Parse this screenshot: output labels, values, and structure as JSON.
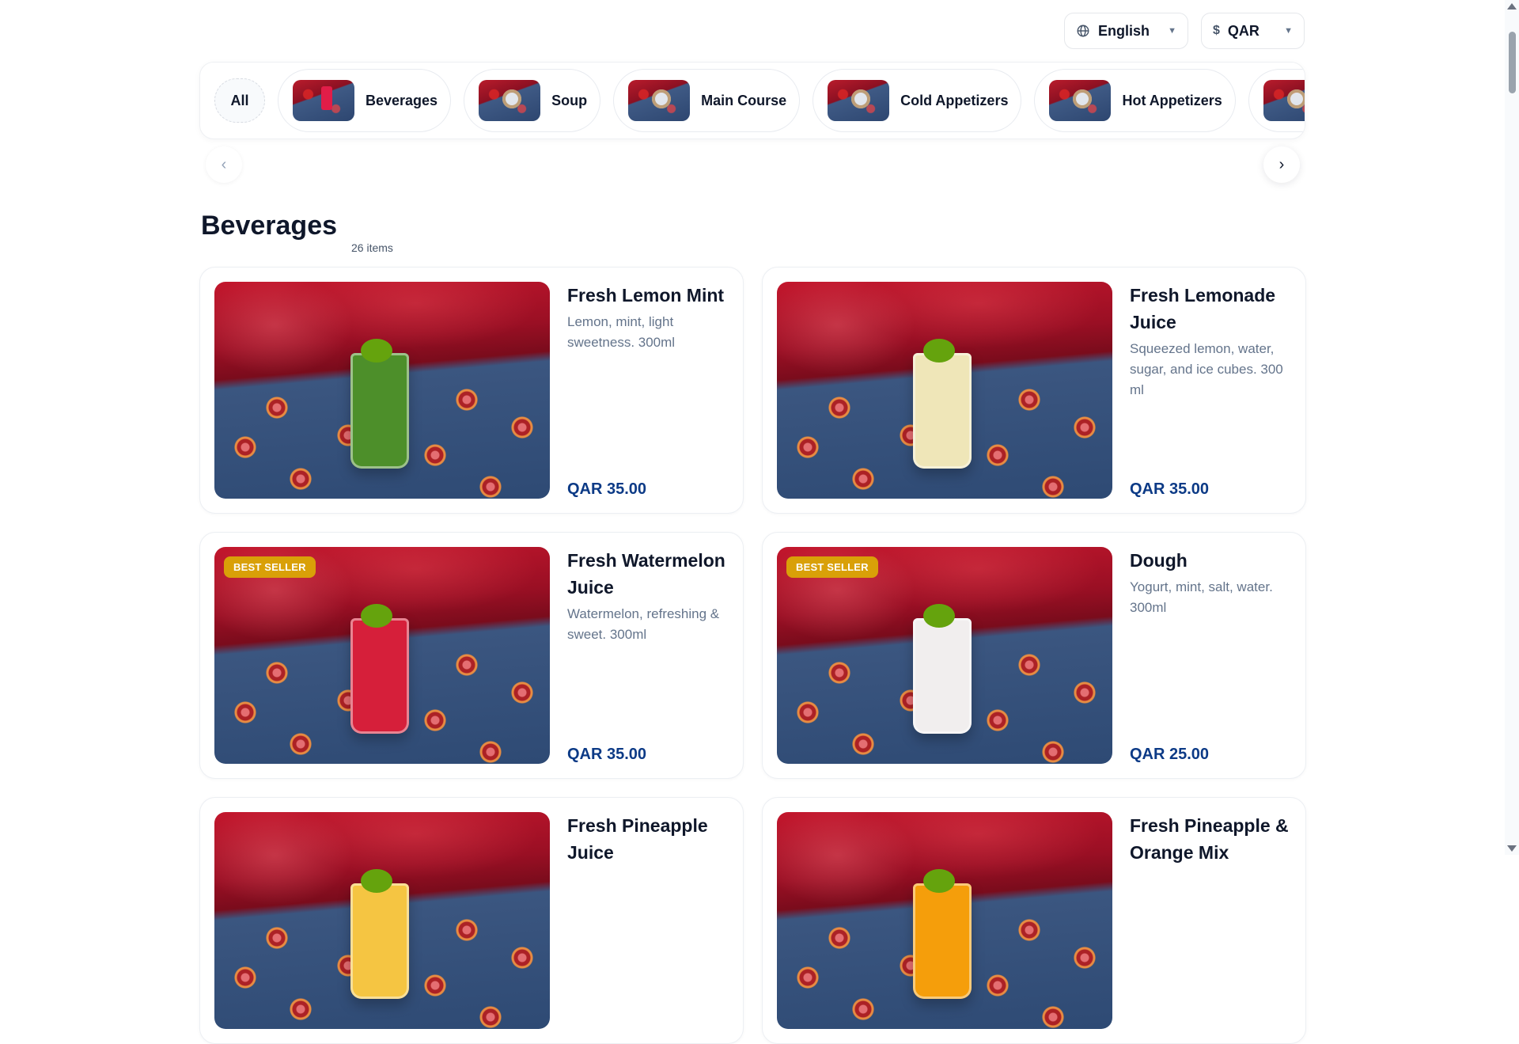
{
  "header": {
    "language": {
      "label": "English",
      "icon": "globe-icon"
    },
    "currency": {
      "label": "QAR",
      "icon": "dollar-icon"
    }
  },
  "categories": [
    {
      "label": "All"
    },
    {
      "label": "Beverages"
    },
    {
      "label": "Soup"
    },
    {
      "label": "Main Course"
    },
    {
      "label": "Cold Appetizers"
    },
    {
      "label": "Hot Appetizers"
    }
  ],
  "section": {
    "title": "Beverages",
    "count": "26 items"
  },
  "products": [
    {
      "name": "Fresh Lemon Mint",
      "desc": "Lemon, mint, light sweetness. 300ml",
      "price": "QAR 35.00",
      "badge": "",
      "drink_color": "#4d8f2a"
    },
    {
      "name": "Fresh Lemonade Juice",
      "desc": "Squeezed lemon, water, sugar, and ice cubes. 300 ml",
      "price": "QAR 35.00",
      "badge": "",
      "drink_color": "#efe6b8"
    },
    {
      "name": "Fresh Watermelon Juice",
      "desc": "Watermelon, refreshing & sweet. 300ml",
      "price": "QAR 35.00",
      "badge": "BEST SELLER",
      "drink_color": "#d61f3a"
    },
    {
      "name": "Dough",
      "desc": "Yogurt, mint, salt, water. 300ml",
      "price": "QAR 25.00",
      "badge": "BEST SELLER",
      "drink_color": "#f1eeee"
    },
    {
      "name": "Fresh Pineapple Juice",
      "desc": "",
      "price": "",
      "badge": "",
      "drink_color": "#f5c542"
    },
    {
      "name": "Fresh Pineapple & Orange Mix",
      "desc": "",
      "price": "",
      "badge": "",
      "drink_color": "#f59e0b"
    }
  ],
  "colors": {
    "accent_price": "#0c3a86",
    "badge_bg": "#d9a008"
  }
}
